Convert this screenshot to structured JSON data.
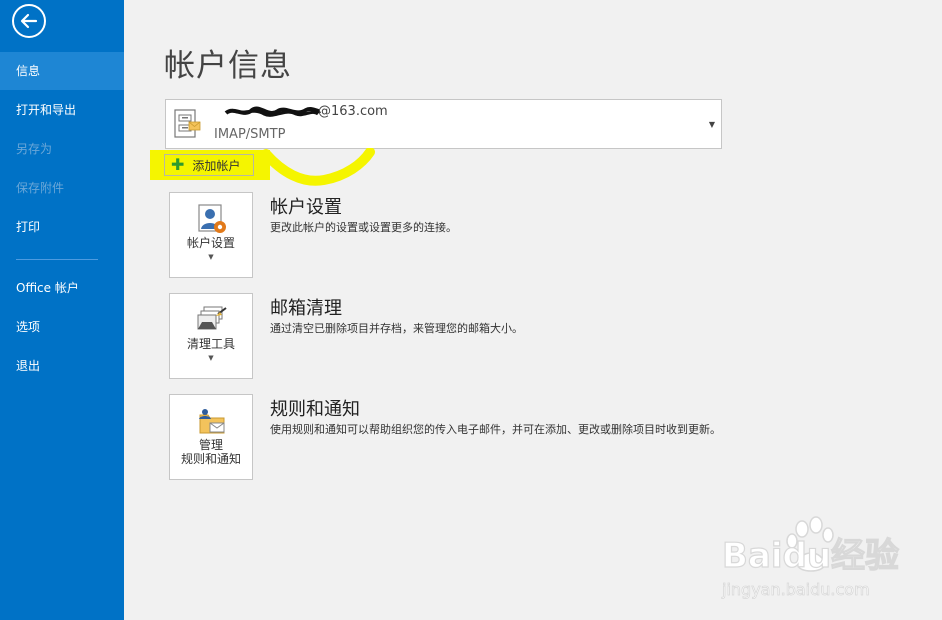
{
  "sidebar": {
    "back_icon": "back-arrow-icon",
    "items": [
      {
        "label": "信息",
        "active": true,
        "disabled": false
      },
      {
        "label": "打开和导出",
        "active": false,
        "disabled": false
      },
      {
        "label": "另存为",
        "active": false,
        "disabled": true
      },
      {
        "label": "保存附件",
        "active": false,
        "disabled": true
      },
      {
        "label": "打印",
        "active": false,
        "disabled": false
      },
      {
        "label": "Office 帐户",
        "active": false,
        "disabled": false
      },
      {
        "label": "选项",
        "active": false,
        "disabled": false
      },
      {
        "label": "退出",
        "active": false,
        "disabled": false
      }
    ]
  },
  "main": {
    "title": "帐户信息",
    "account": {
      "email": "@163.com",
      "type": "IMAP/SMTP",
      "icon": "mailbox-icon"
    },
    "add_account_label": "添加帐户",
    "sections": [
      {
        "button_label": "帐户设置",
        "has_dropdown": true,
        "icon": "account-settings-icon",
        "title": "帐户设置",
        "description": "更改此帐户的设置或设置更多的连接。"
      },
      {
        "button_label": "清理工具",
        "has_dropdown": true,
        "icon": "cleanup-tools-icon",
        "title": "邮箱清理",
        "description": "通过清空已删除项目并存档，来管理您的邮箱大小。"
      },
      {
        "button_label_line1": "管理",
        "button_label_line2": "规则和通知",
        "has_dropdown": false,
        "icon": "rules-alerts-icon",
        "title": "规则和通知",
        "description": "使用规则和通知可以帮助组织您的传入电子邮件，并可在添加、更改或删除项目时收到更新。"
      }
    ]
  },
  "watermark": {
    "brand_text": "Baidu经验",
    "url": "jingyan.baidu.com"
  },
  "colors": {
    "sidebar_bg": "#0072c6",
    "sidebar_active": "#1e86d4",
    "highlight": "#f5f500",
    "page_bg": "#f1f1f1"
  }
}
